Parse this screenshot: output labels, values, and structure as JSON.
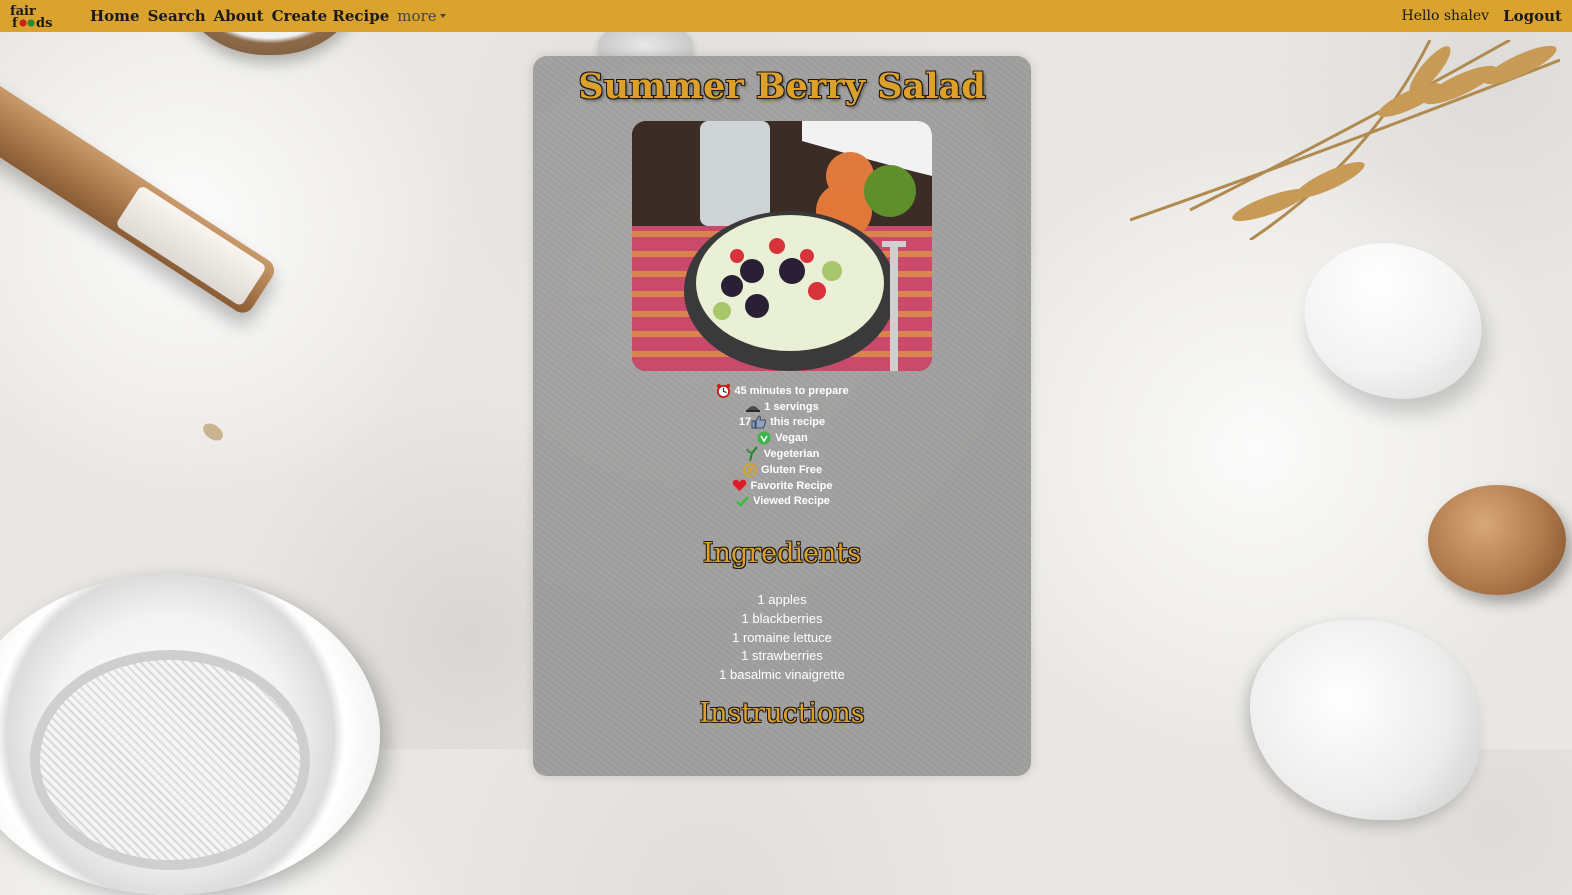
{
  "navbar": {
    "logo_text": "fair foods",
    "links": [
      {
        "label": "Home"
      },
      {
        "label": "Search"
      },
      {
        "label": "About"
      },
      {
        "label": "Create Recipe"
      }
    ],
    "more_label": "more",
    "greeting": "Hello shalev",
    "logout_label": "Logout",
    "color": "#DAA32E"
  },
  "recipe": {
    "title": "Summer Berry Salad",
    "prep_time": "45 minutes to prepare",
    "servings": "1 servings",
    "likes_count": "17",
    "likes_suffix": "this recipe",
    "tags": [
      {
        "label": "Vegan",
        "icon": "vegan-icon"
      },
      {
        "label": "Vegeterian",
        "icon": "vegetarian-sprout-icon"
      },
      {
        "label": "Gluten Free",
        "icon": "gluten-free-icon"
      },
      {
        "label": "Favorite Recipe",
        "icon": "heart-icon"
      },
      {
        "label": "Viewed Recipe",
        "icon": "checkmark-icon"
      }
    ],
    "ingredients_heading": "Ingredients",
    "ingredients": [
      "1 apples",
      "1 blackberries",
      "1 romaine lettuce",
      "1 strawberries",
      "1 basalmic vinaigrette"
    ],
    "instructions_heading": "Instructions",
    "accent_color": "#DCA02B"
  }
}
